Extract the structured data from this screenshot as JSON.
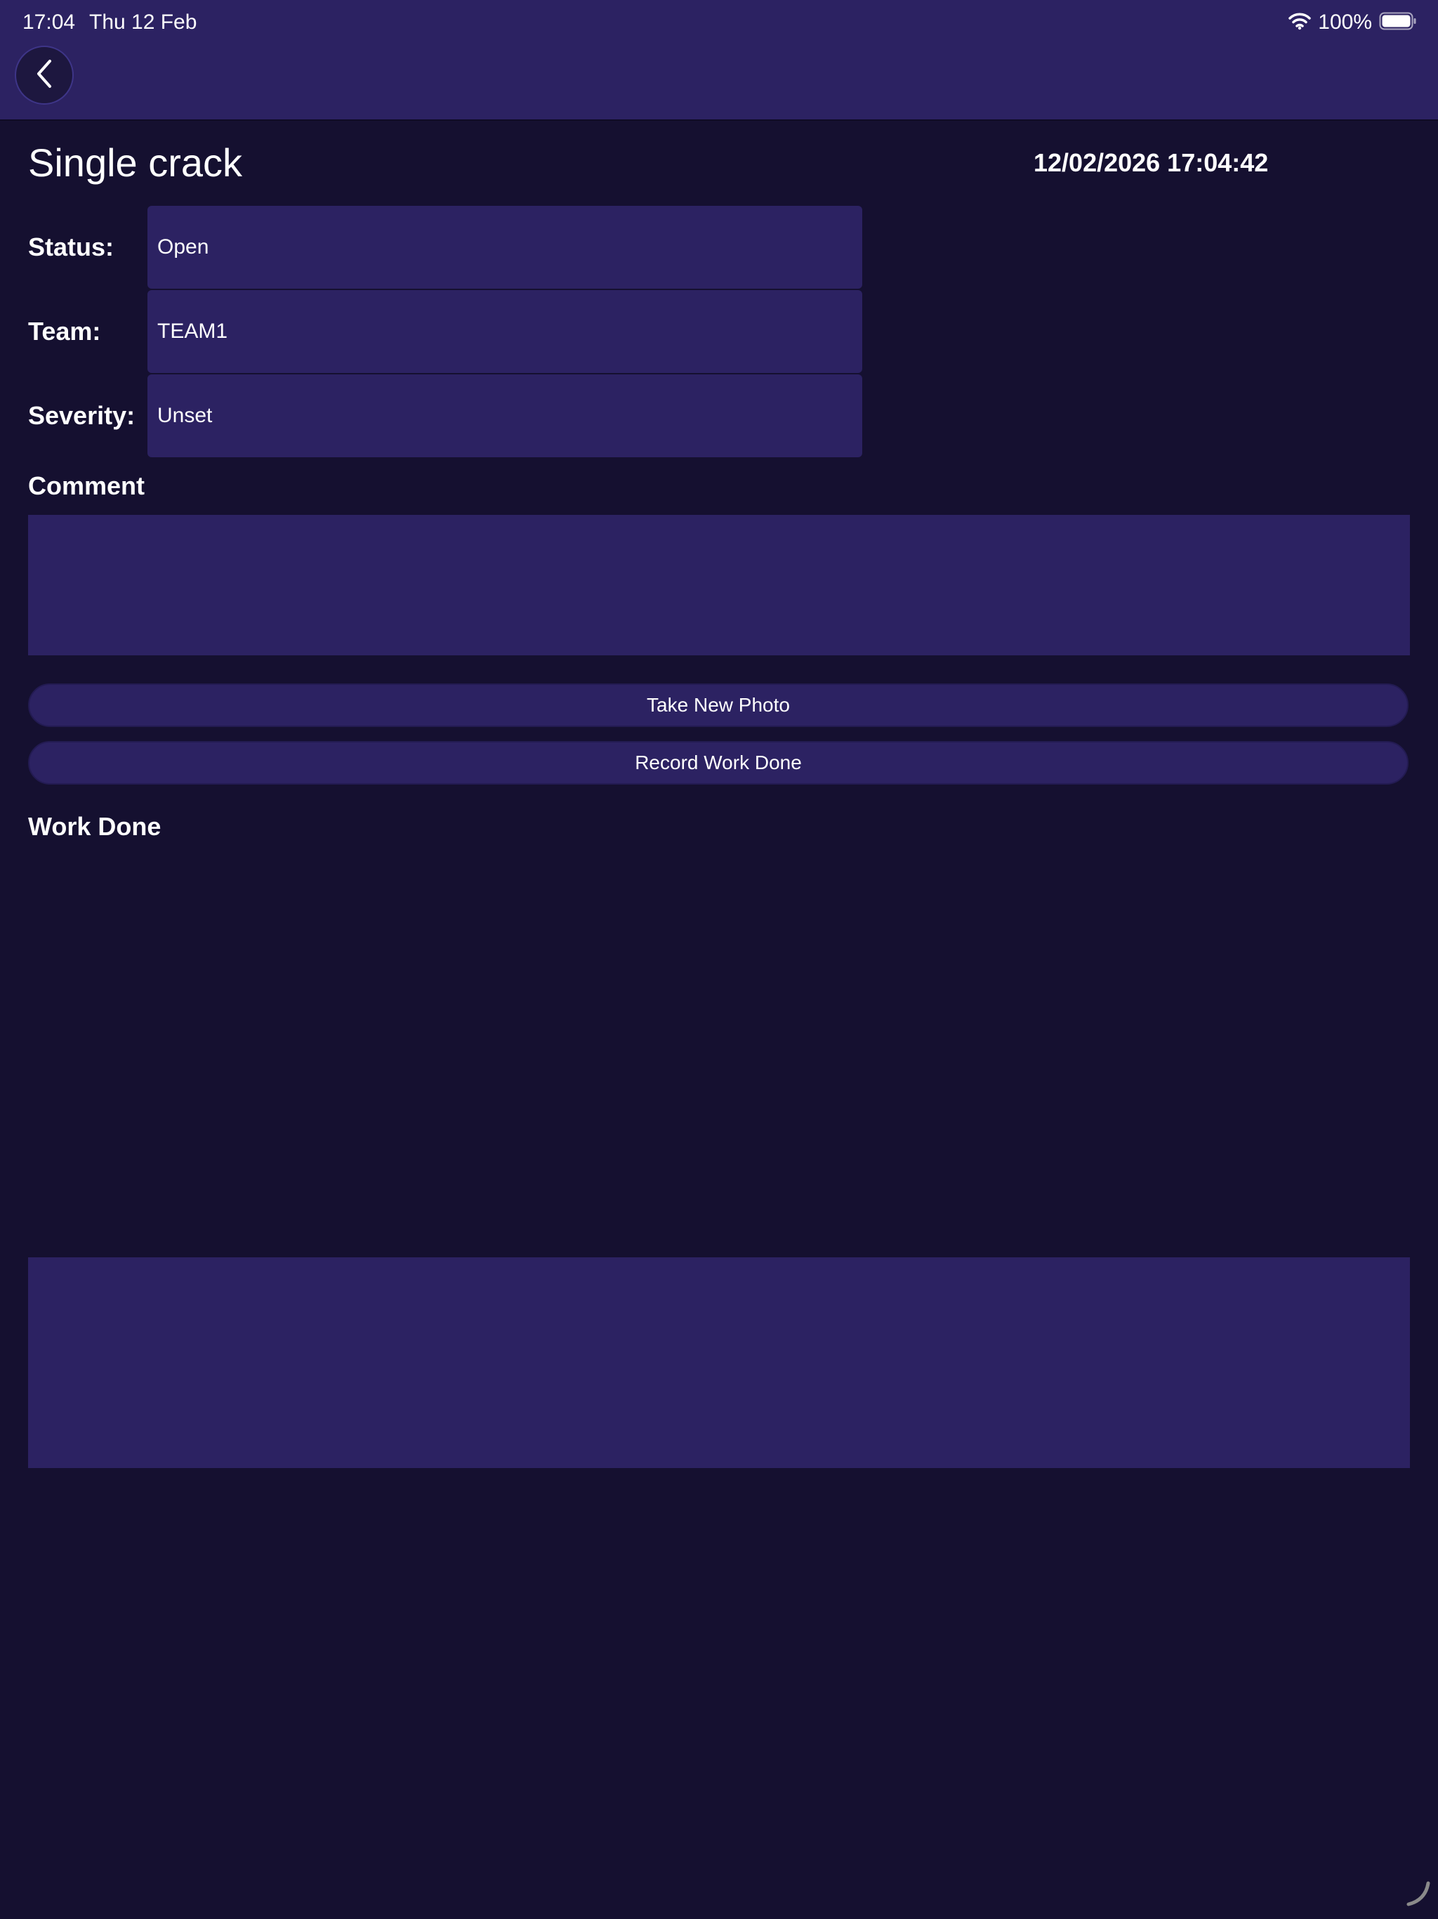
{
  "status_bar": {
    "time": "17:04",
    "date": "Thu 12 Feb",
    "battery_percent": "100%",
    "wifi_icon": "wifi-icon",
    "battery_icon": "battery-icon"
  },
  "nav": {
    "back_icon": "chevron-left-icon"
  },
  "header": {
    "title": "Single crack",
    "datetime": "12/02/2026 17:04:42"
  },
  "fields": {
    "status": {
      "label": "Status:",
      "value": "Open"
    },
    "team": {
      "label": "Team:",
      "value": "TEAM1"
    },
    "severity": {
      "label": "Severity:",
      "value": "Unset"
    }
  },
  "comment": {
    "label": "Comment",
    "value": ""
  },
  "buttons": {
    "take_photo": "Take New Photo",
    "record_work": "Record Work Done"
  },
  "work_done": {
    "label": "Work Done"
  },
  "colors": {
    "background": "#151030",
    "panel": "#2c2262",
    "text": "#ffffff"
  }
}
